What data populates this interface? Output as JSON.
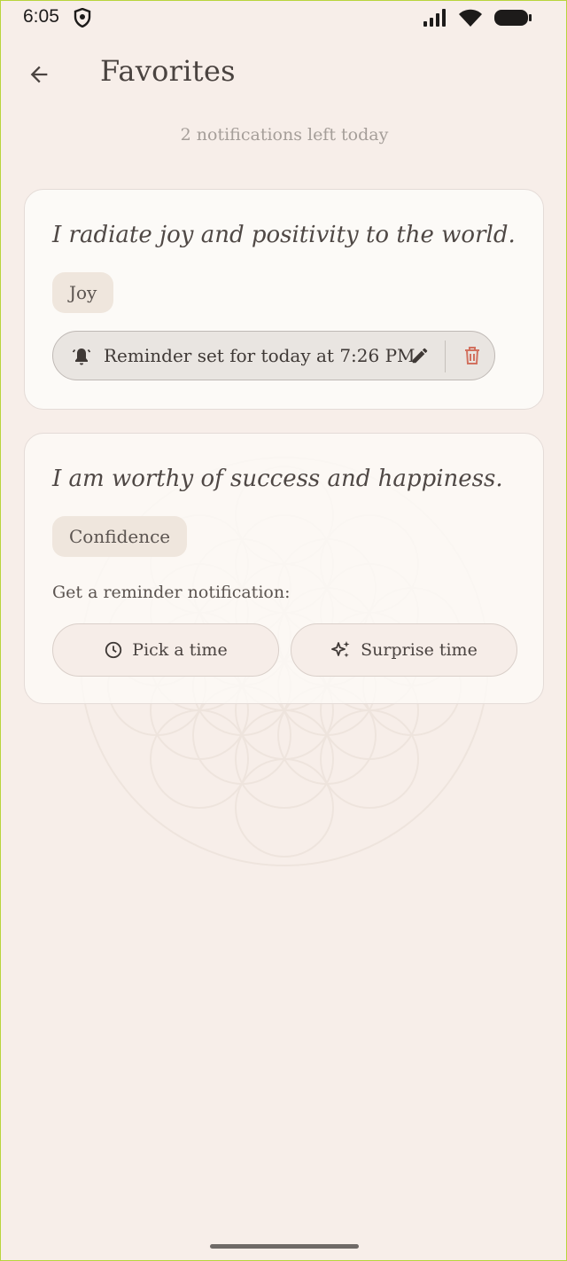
{
  "status": {
    "time": "6:05"
  },
  "header": {
    "title": "Favorites",
    "back_icon": "arrow-left-icon"
  },
  "subtitle": "2 notifications left today",
  "cards": [
    {
      "quote": "I radiate joy and positivity to the world.",
      "tag": "Joy",
      "reminder_text": "Reminder set for today at 7:26 PM"
    },
    {
      "quote": "I am worthy of success and happiness.",
      "tag": "Confidence",
      "reminder_prompt": "Get a reminder notification:",
      "pick_time_label": "Pick a time",
      "surprise_label": "Surprise time"
    }
  ],
  "colors": {
    "background": "#f7eee9",
    "card": "#fcfaf7",
    "delete": "#d2715f"
  }
}
